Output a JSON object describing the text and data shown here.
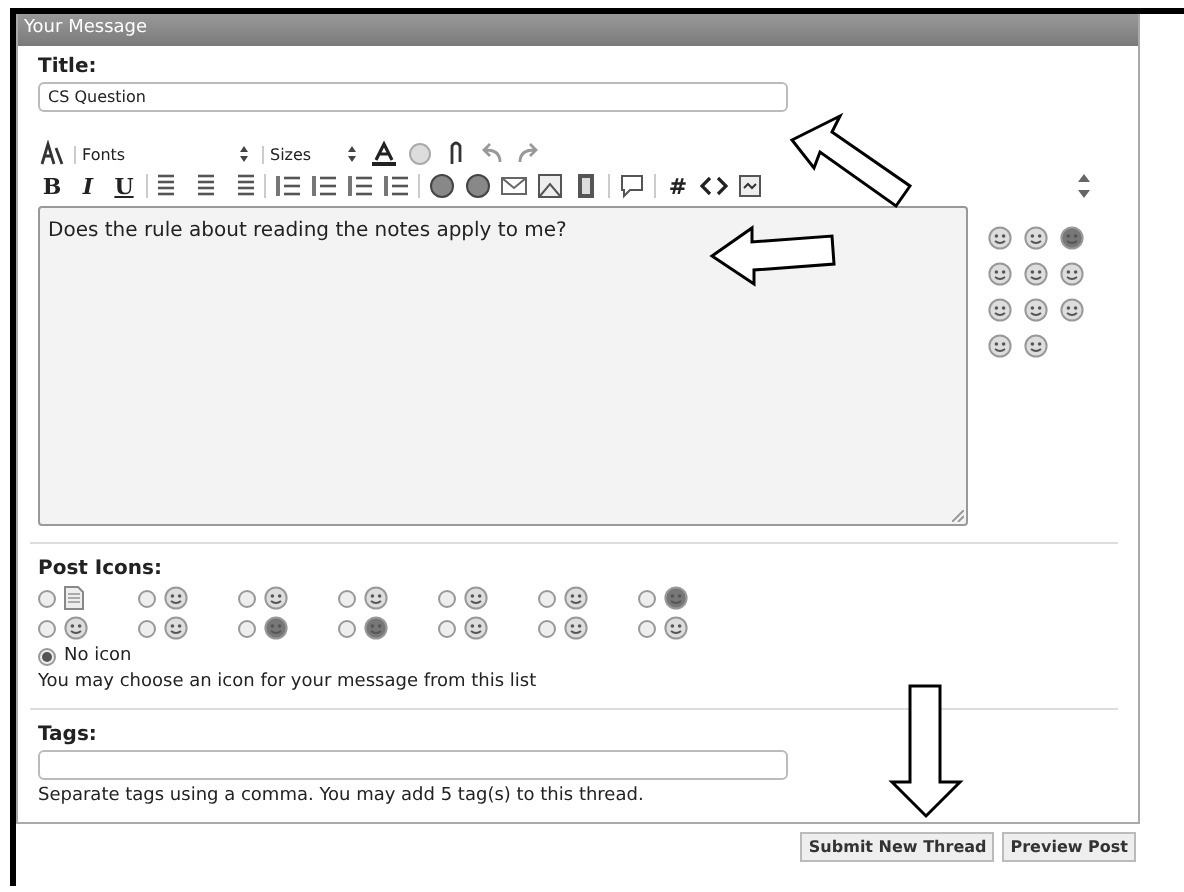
{
  "panel": {
    "title": "Your Message"
  },
  "title_field": {
    "label": "Title:",
    "value": "CS Question"
  },
  "toolbar": {
    "font_select": "Fonts",
    "size_select": "Sizes",
    "bold": "B",
    "italic": "I",
    "underline": "U",
    "hash": "#"
  },
  "message": {
    "value": "Does the rule about reading the notes apply to me?"
  },
  "post_icons": {
    "label": "Post Icons:",
    "options": [
      {
        "selected": false
      },
      {
        "selected": false
      },
      {
        "selected": false
      },
      {
        "selected": false
      },
      {
        "selected": false
      },
      {
        "selected": false
      },
      {
        "selected": false
      },
      {
        "selected": false
      },
      {
        "selected": false
      },
      {
        "selected": false
      },
      {
        "selected": false
      },
      {
        "selected": false
      },
      {
        "selected": false
      },
      {
        "selected": false
      }
    ],
    "no_icon": {
      "label": "No icon",
      "selected": true
    },
    "help": "You may choose an icon for your message from this list"
  },
  "tags": {
    "label": "Tags:",
    "help": "Separate tags using a comma. You may add 5 tag(s) to this thread."
  },
  "buttons": [
    "Submit New Thread",
    "Preview Post"
  ]
}
